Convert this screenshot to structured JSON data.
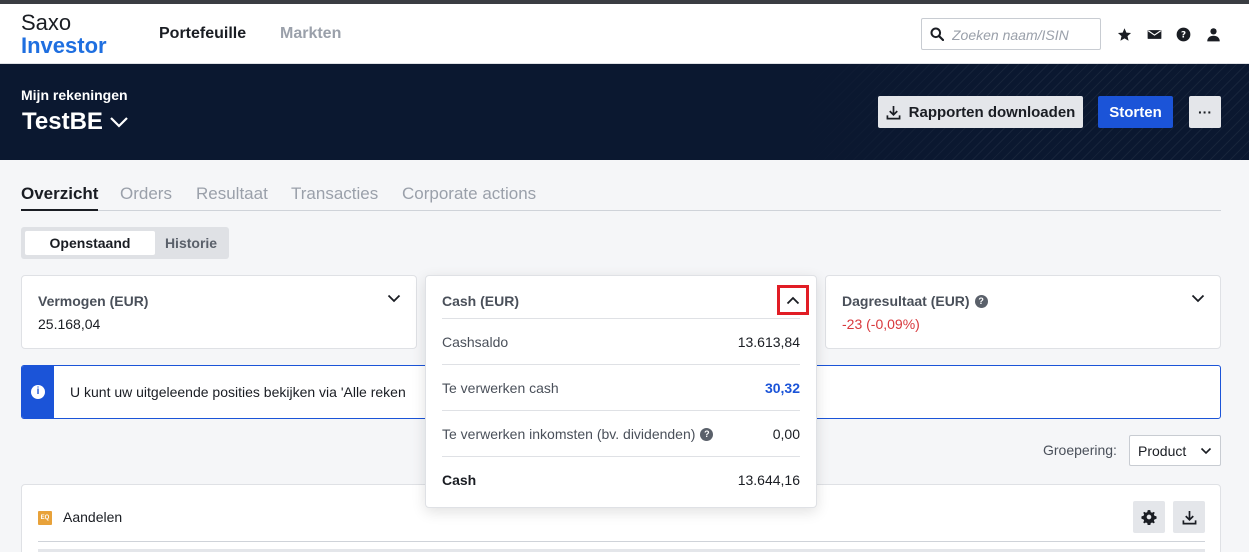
{
  "brand": {
    "line1": "Saxo",
    "line2": "Investor"
  },
  "topnav": {
    "items": [
      "Portefeuille",
      "Markten"
    ]
  },
  "search": {
    "placeholder": "Zoeken naam/ISIN",
    "value": ""
  },
  "top_icons": [
    "star-icon",
    "mail-icon",
    "help-icon",
    "user-icon"
  ],
  "header": {
    "label": "Mijn rekeningen",
    "account": "TestBE",
    "reports_button": "Rapporten downloaden",
    "deposit_button": "Storten",
    "more_button": "···"
  },
  "tabs": [
    "Overzicht",
    "Orders",
    "Resultaat",
    "Transacties",
    "Corporate actions"
  ],
  "segment": {
    "open": "Openstaand",
    "history": "Historie"
  },
  "cards": {
    "equity": {
      "title": "Vermogen (EUR)",
      "value": "25.168,04"
    },
    "cash": {
      "title": "Cash (EUR)"
    },
    "day": {
      "title": "Dagresultaat (EUR)",
      "value": "-23 (-0,09%)"
    }
  },
  "cash_popup": {
    "rows": [
      {
        "label": "Cashsaldo",
        "value": "13.613,84"
      },
      {
        "label": "Te verwerken cash",
        "value": "30,32"
      },
      {
        "label": "Te verwerken inkomsten (bv. dividenden)",
        "value": "0,00"
      },
      {
        "label": "Cash",
        "value": "13.644,16"
      }
    ]
  },
  "info": {
    "icon": "i",
    "text": "U kunt uw uitgeleende posities bekijken via 'Alle reken"
  },
  "grouping": {
    "label": "Groepering:",
    "value": "Product"
  },
  "section": {
    "badge": "EQ",
    "title": "Aandelen"
  },
  "colors": {
    "brand_blue": "#1f6fe0",
    "primary": "#1b54d8",
    "hero_bg": "#0b1830",
    "negative": "#d8383c",
    "highlight": "#e11d25"
  }
}
